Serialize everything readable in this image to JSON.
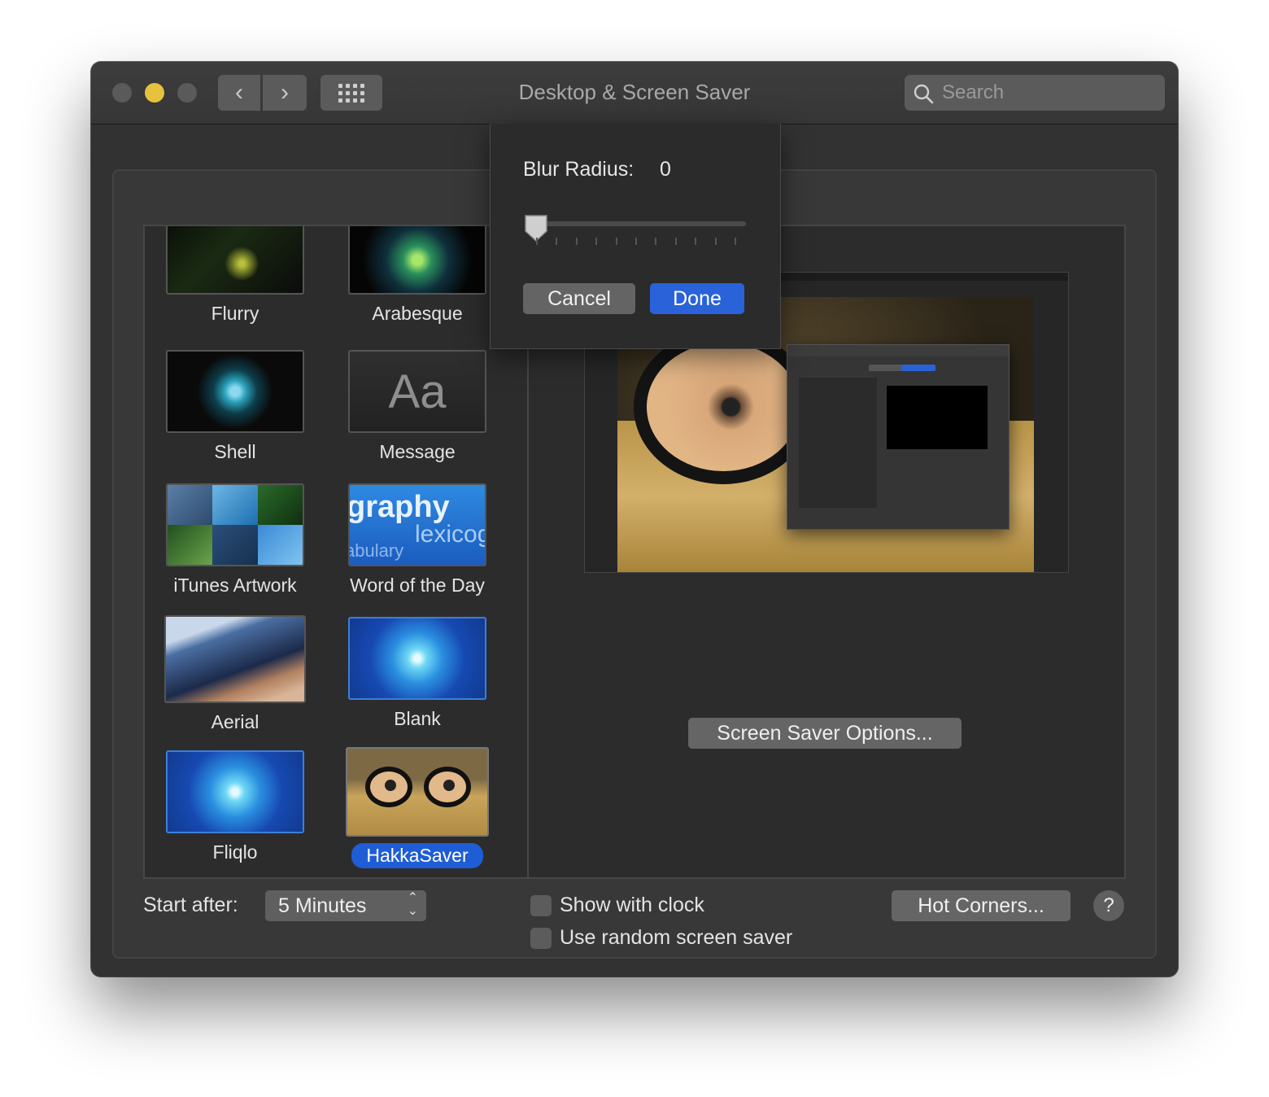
{
  "window": {
    "title": "Desktop & Screen Saver",
    "search_placeholder": "Search"
  },
  "savers": [
    {
      "label": "Flurry",
      "icon": "flurry-thumbnail"
    },
    {
      "label": "Arabesque",
      "icon": "arabesque-thumbnail"
    },
    {
      "label": "Shell",
      "icon": "shell-thumbnail"
    },
    {
      "label": "Message",
      "icon": "message-thumbnail",
      "thumb_text": "Aa"
    },
    {
      "label": "iTunes Artwork",
      "icon": "itunes-artwork-thumbnail"
    },
    {
      "label": "Word of the Day",
      "icon": "word-of-the-day-thumbnail",
      "thumb_words": [
        "graphy",
        "lexicog",
        "abulary"
      ]
    },
    {
      "label": "Aerial",
      "icon": "aerial-thumbnail"
    },
    {
      "label": "Blank",
      "icon": "blank-thumbnail"
    },
    {
      "label": "Fliqlo",
      "icon": "fliqlo-thumbnail"
    },
    {
      "label": "HakkaSaver",
      "icon": "hakkasaver-thumbnail",
      "selected": true
    }
  ],
  "preview": {
    "options_button": "Screen Saver Options..."
  },
  "footer": {
    "start_after_label": "Start after:",
    "start_after_value": "5 Minutes",
    "show_clock_label": "Show with clock",
    "show_clock_checked": false,
    "random_label": "Use random screen saver",
    "random_checked": false,
    "hot_corners_button": "Hot Corners...",
    "help_button": "?"
  },
  "popover": {
    "blur_label": "Blur Radius:",
    "blur_value": "0",
    "slider_level": 0,
    "cancel_button": "Cancel",
    "done_button": "Done"
  },
  "colors": {
    "accent": "#2a63d9",
    "minimize": "#e7c23e",
    "window_bg": "#323232"
  }
}
